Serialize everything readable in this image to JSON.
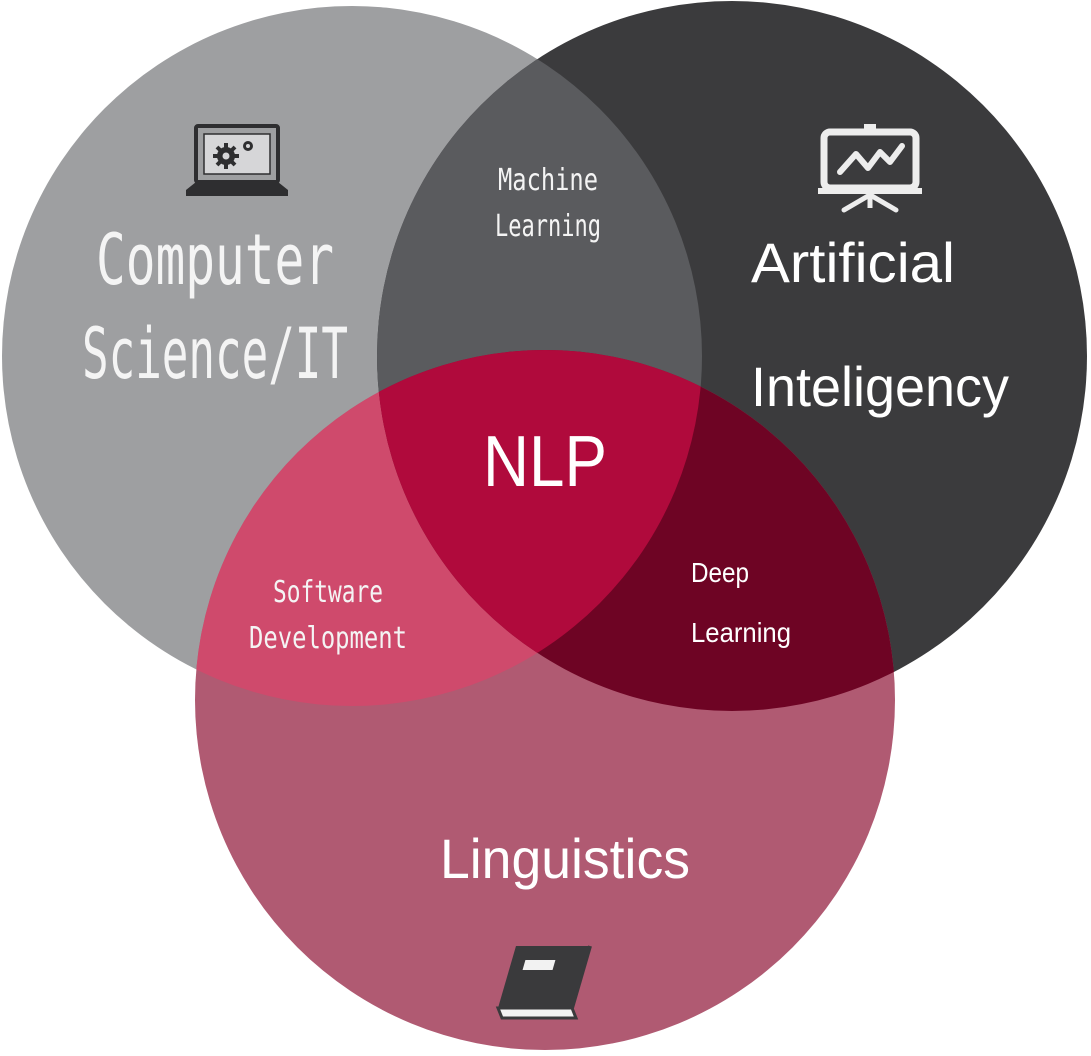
{
  "diagram": {
    "sets": [
      {
        "id": "cs",
        "lines": [
          "Computer",
          "Science/IT"
        ],
        "icon": "laptop-gears-icon",
        "color": "#9e9fa1"
      },
      {
        "id": "ai",
        "lines": [
          "Artificial",
          "Inteligency"
        ],
        "icon": "presentation-chart-icon",
        "color": "#3b3b3d"
      },
      {
        "id": "ling",
        "lines": [
          "Linguistics"
        ],
        "icon": "book-icon",
        "color": "#b05a72"
      }
    ],
    "overlaps": {
      "cs_ai": [
        "Machine",
        "Learning"
      ],
      "cs_ling": [
        "Software",
        "Development"
      ],
      "ai_ling": [
        "Deep",
        "Learning"
      ],
      "center": "NLP"
    },
    "colors": {
      "cs_ai": "#5a5b5e",
      "cs_ling": "#cf4a6c",
      "ai_ling": "#6e0424",
      "center": "#b00a3c"
    }
  }
}
